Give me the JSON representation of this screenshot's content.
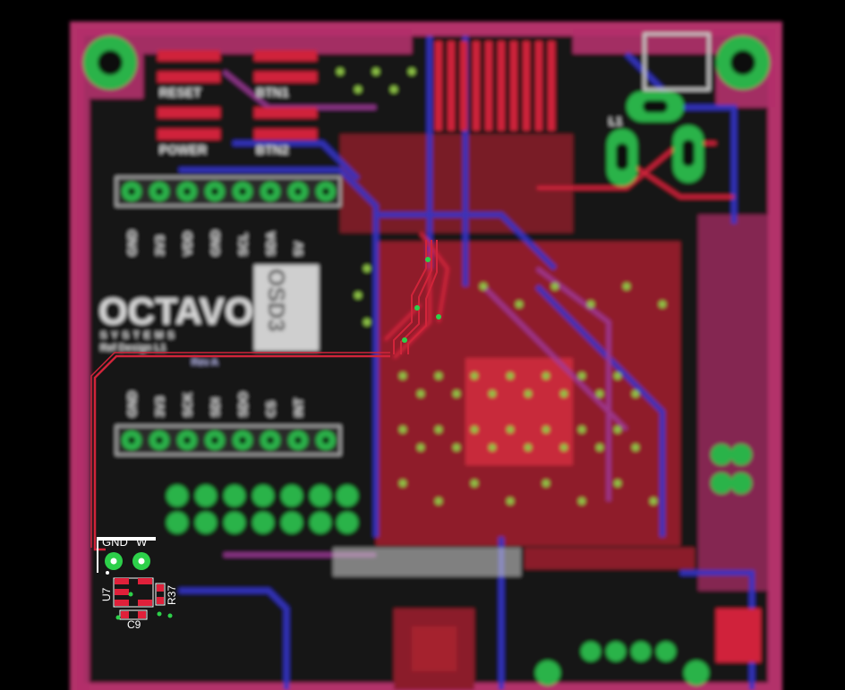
{
  "board": {
    "logo_text": "OCTAVO",
    "logo_subtext": "SYSTEMS",
    "logo_tag": "Ref Design L1",
    "chip_mark": "OSD3",
    "rev_text": "Rev A",
    "button_labels": [
      "RESET",
      "BTN1",
      "POWER",
      "BTN2"
    ],
    "header_top_labels": [
      "GND",
      "3V3",
      "VDD",
      "GND",
      "SCL",
      "SDA",
      "5V"
    ],
    "header_bottom_labels": [
      "GND",
      "3V3",
      "SCK",
      "SDI",
      "SDO",
      "CS",
      "INT"
    ],
    "inductor_label": "L1",
    "bottom_left": {
      "gnd_label": "GND",
      "w_label": "W",
      "u7_label": "U7",
      "c9_label": "C9",
      "r37_label": "R37"
    }
  },
  "colors": {
    "background": "#000000",
    "board_outline": "#b3306b",
    "copper_top": "#d0243a",
    "copper_bottom": "#3434c8",
    "pad_green": "#29b34a",
    "silkscreen": "#d8d8d8"
  }
}
